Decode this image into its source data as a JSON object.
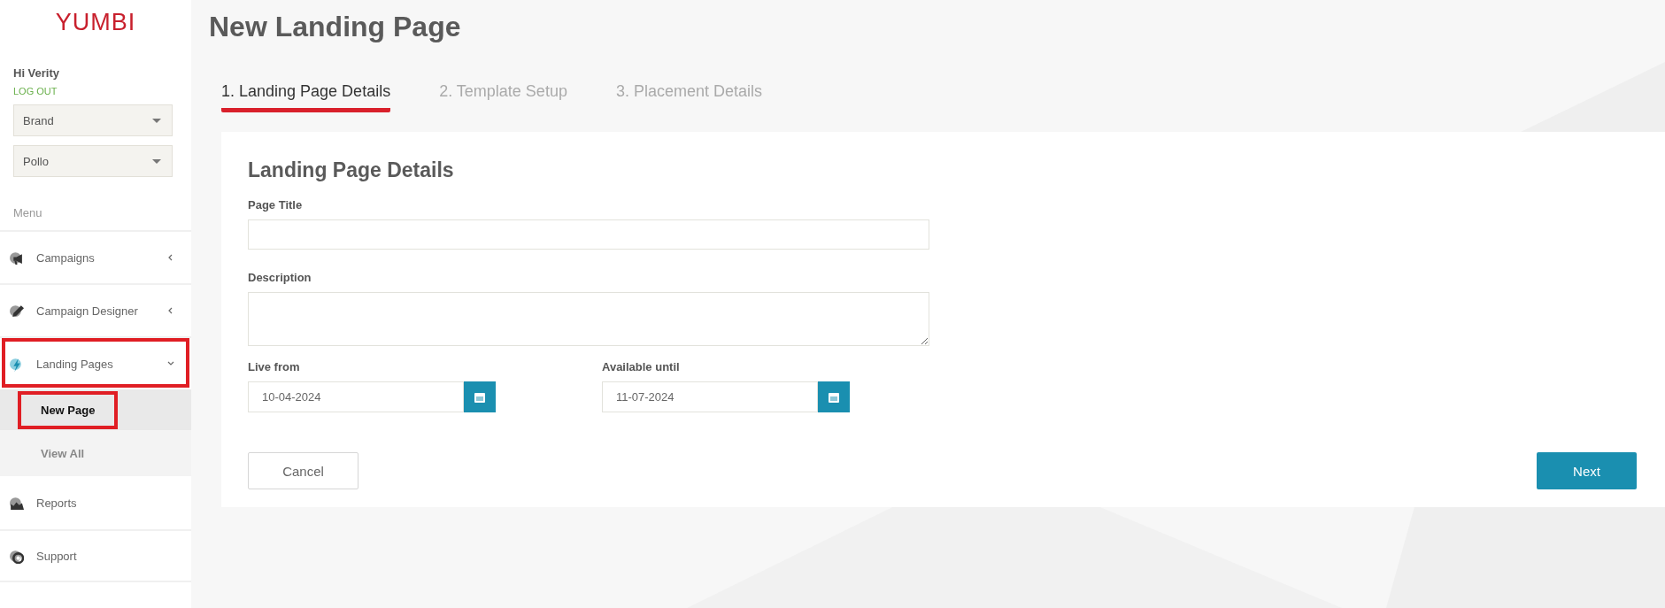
{
  "sidebar": {
    "logo": "YUMBI",
    "greeting": "Hi Verity",
    "logout": "LOG OUT",
    "selects": [
      {
        "value": "Brand"
      },
      {
        "value": "Pollo"
      }
    ],
    "menu_label": "Menu",
    "items": [
      {
        "label": "Campaigns",
        "expanded": false,
        "highlighted": false
      },
      {
        "label": "Campaign Designer",
        "expanded": false,
        "highlighted": false
      },
      {
        "label": "Landing Pages",
        "expanded": true,
        "highlighted": true,
        "children": [
          {
            "label": "New Page",
            "selected": true,
            "highlighted": true
          },
          {
            "label": "View All",
            "selected": false,
            "highlighted": false
          }
        ]
      },
      {
        "label": "Reports",
        "highlighted": false
      },
      {
        "label": "Support",
        "highlighted": false
      }
    ]
  },
  "page_title": "New Landing Page",
  "tabs": [
    {
      "label": "1. Landing Page Details",
      "selected": true
    },
    {
      "label": "2. Template Setup",
      "selected": false
    },
    {
      "label": "3. Placement Details",
      "selected": false
    }
  ],
  "form": {
    "heading": "Landing Page Details",
    "fields": [
      {
        "label": "Page Title",
        "kind": "text"
      },
      {
        "label": "Description",
        "kind": "textarea"
      }
    ],
    "dates": [
      {
        "label": "Live from",
        "value": "10-04-2024"
      },
      {
        "label": "Available until",
        "value": "11-07-2024"
      }
    ],
    "cancel": "Cancel",
    "next": "Next"
  }
}
